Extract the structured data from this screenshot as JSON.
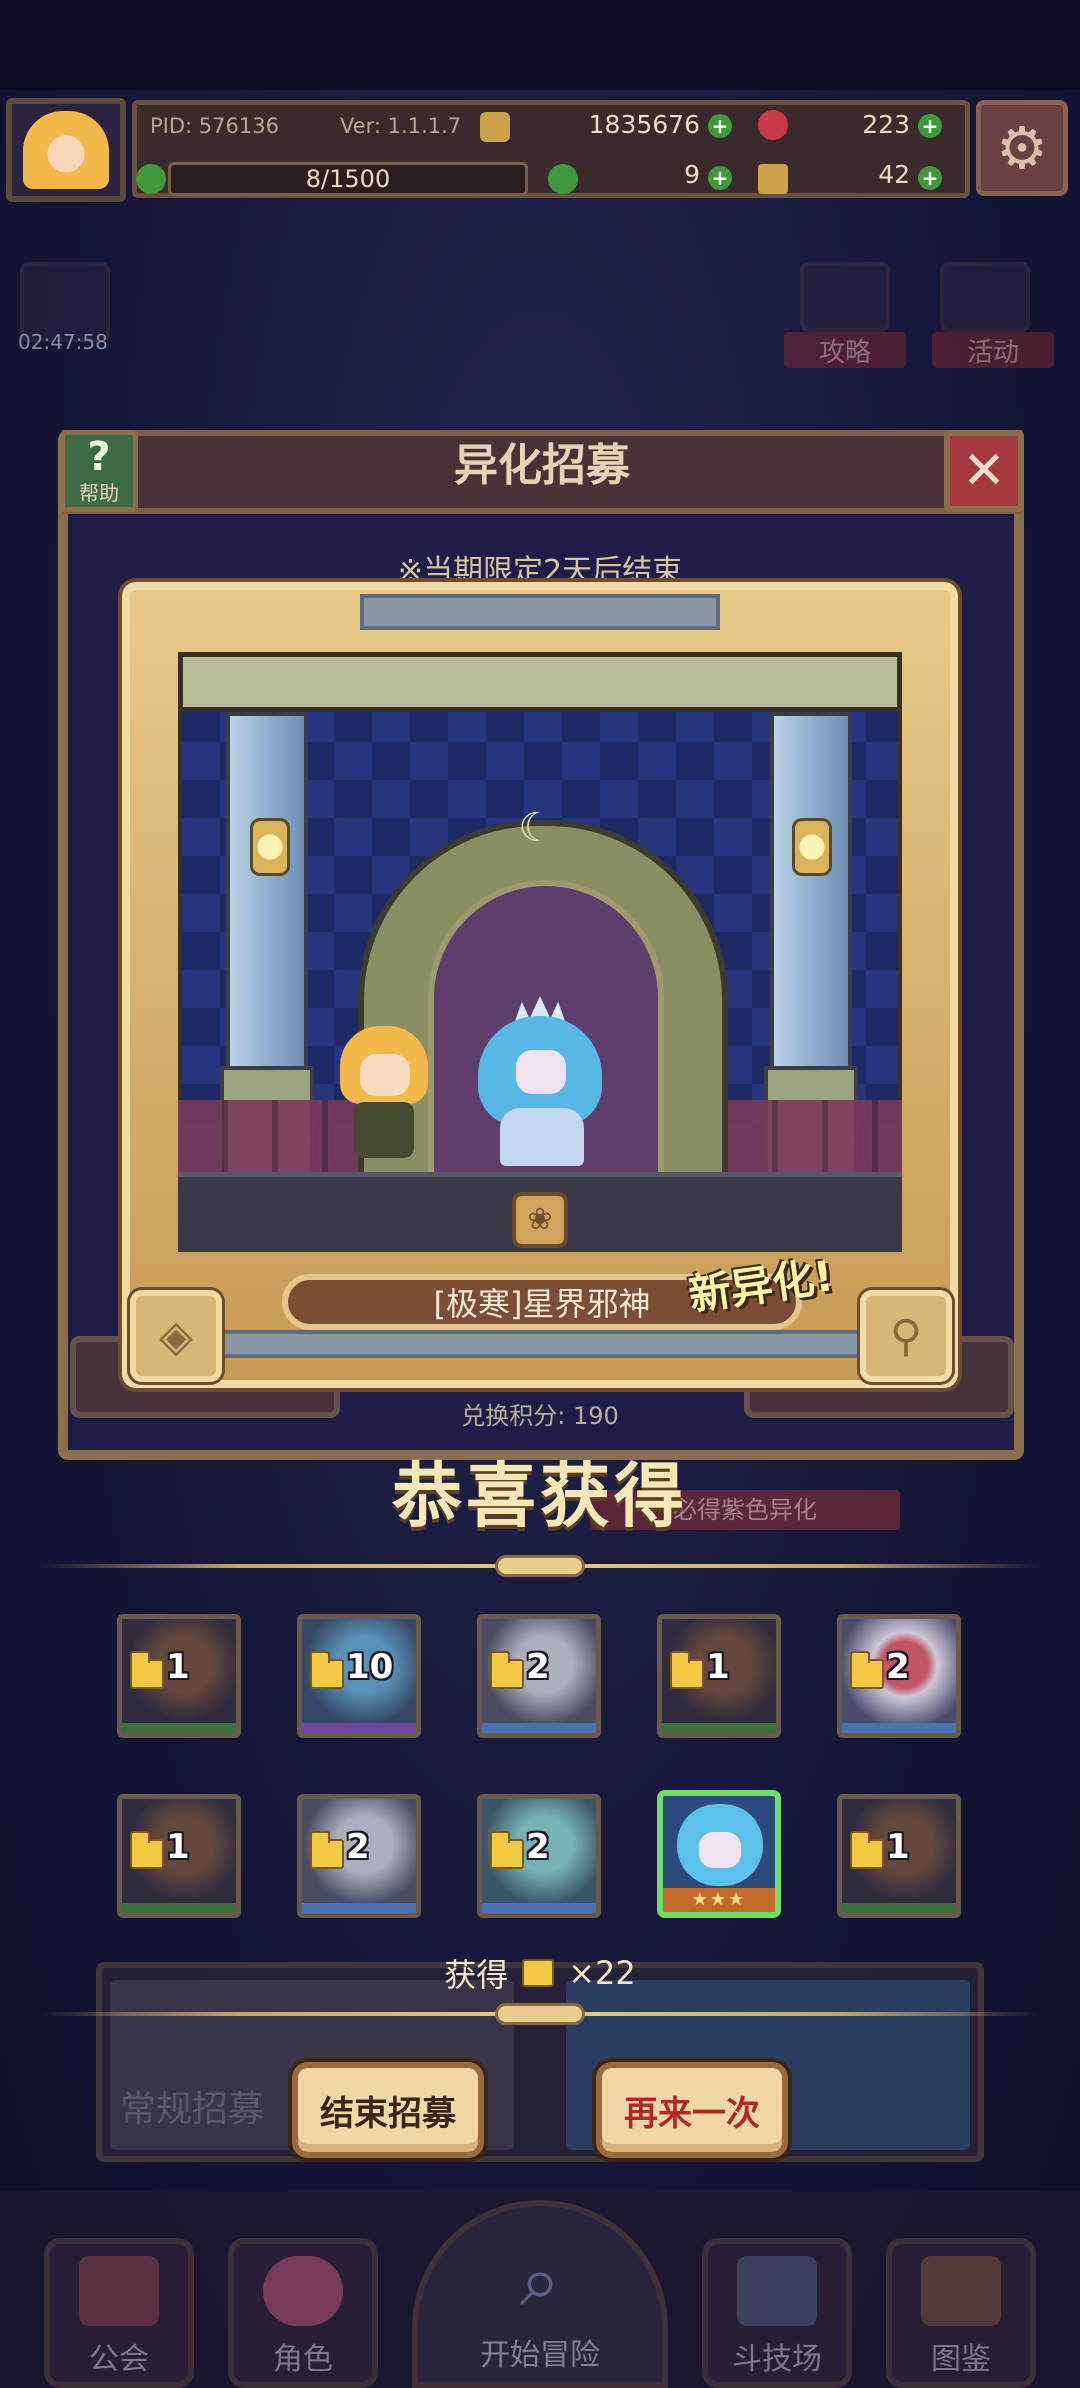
{
  "hud": {
    "pid": "PID: 576136",
    "version": "Ver: 1.1.1.7",
    "gold": "1835676",
    "gems": "223",
    "exp_progress": "8/1500",
    "clover": "9",
    "keys": "42"
  },
  "background": {
    "timer": "02:47:58",
    "strategy_label": "攻略",
    "event_label": "活动"
  },
  "window": {
    "title": "异化招募",
    "help_label": "帮助",
    "period_notice": "※当期限定2天后结束",
    "exchange_points": "兑换积分: 190",
    "guarantee_tag": "必得紫色异化"
  },
  "card": {
    "character_name": "[极寒]星界邪神",
    "new_badge": "新异化!"
  },
  "result": {
    "congrats": "恭喜获得",
    "rewards_row1": [
      {
        "count": "1",
        "color": "#3c6e3e"
      },
      {
        "count": "10",
        "color": "#6e46a0"
      },
      {
        "count": "2",
        "color": "#4a72b0"
      },
      {
        "count": "1",
        "color": "#3c6e3e"
      },
      {
        "count": "2",
        "color": "#4a72b0"
      }
    ],
    "rewards_row2": [
      {
        "count": "1",
        "color": "#3c6e3e"
      },
      {
        "count": "2",
        "color": "#4a72b0"
      },
      {
        "count": "2",
        "color": "#4a72b0"
      },
      {
        "count": "",
        "stars": "★★★",
        "is_new": true
      },
      {
        "count": "1",
        "color": "#3c6e3e"
      }
    ],
    "gain_prefix": "获得",
    "gain_amount": "×22",
    "background_label": "常规招募",
    "end_button": "结束招募",
    "again_button": "再来一次"
  },
  "nav": {
    "guild": "公会",
    "characters": "角色",
    "adventure": "开始冒险",
    "arena": "斗技场",
    "codex": "图鉴"
  },
  "colors": {
    "accent_gold": "#e7cd8d",
    "frame_brown": "#8b6f4c",
    "new_green": "#6ee06a",
    "button_text_dark": "#3a2616",
    "button_text_red": "#b0282a"
  }
}
